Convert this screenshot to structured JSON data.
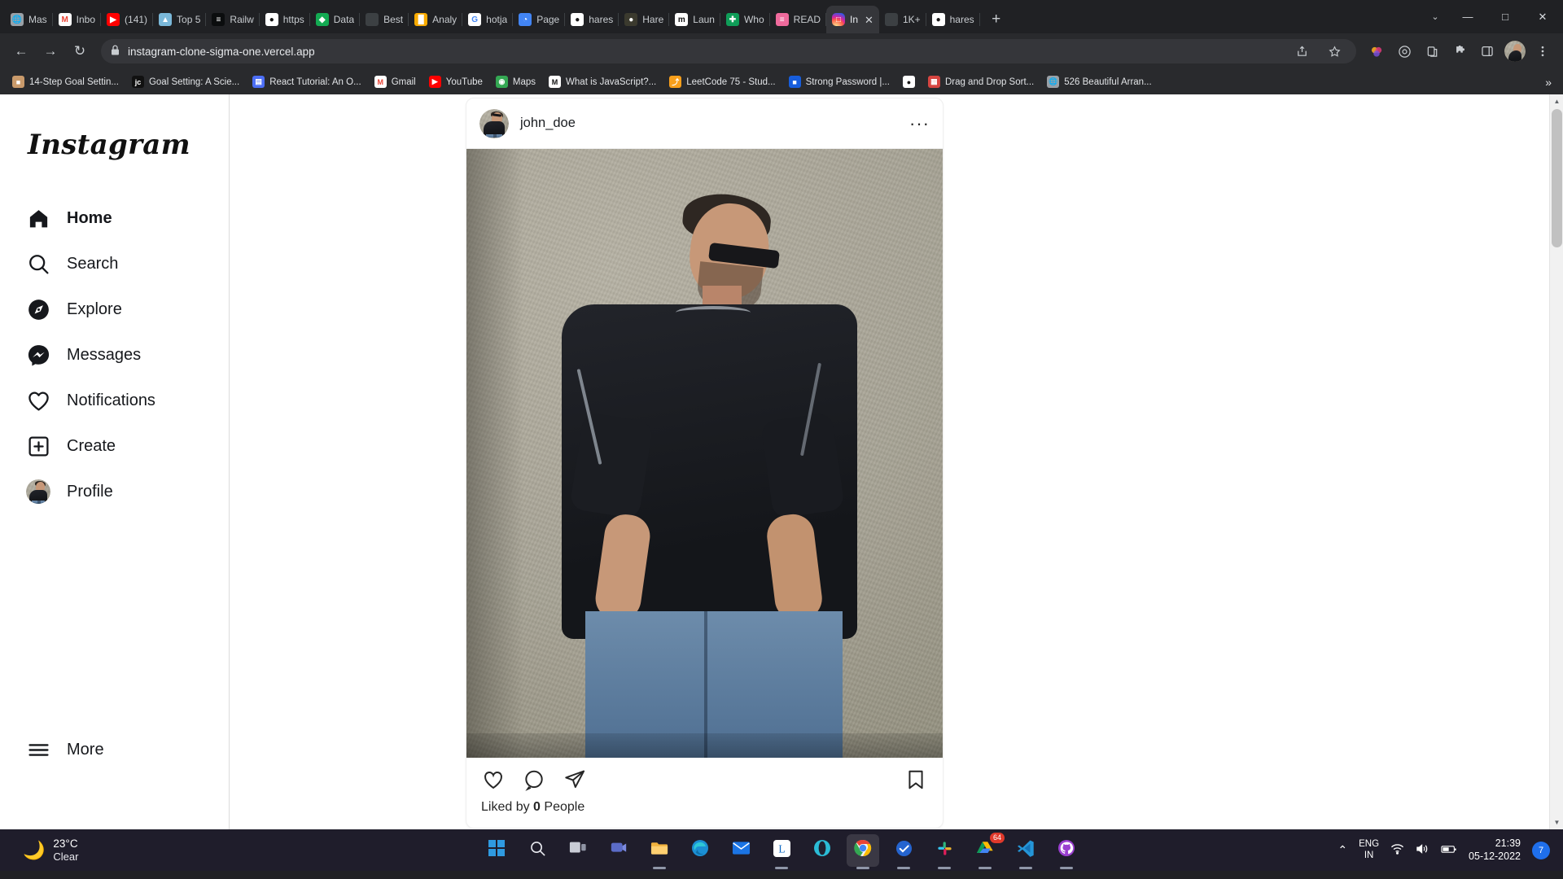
{
  "browser": {
    "tabs": [
      {
        "label": "Mas",
        "favicon": "globe-icon",
        "color": "#9aa0a6",
        "active": false
      },
      {
        "label": "Inbo",
        "favicon": "gmail-icon",
        "color": "#ffffff",
        "active": false
      },
      {
        "label": "(141)",
        "favicon": "youtube-icon",
        "color": "#ff0000",
        "active": false
      },
      {
        "label": "Top 5",
        "favicon": "mountain-icon",
        "color": "#7ab8d9",
        "active": false
      },
      {
        "label": "Railw",
        "favicon": "railway-icon",
        "color": "#0b0d0e",
        "active": false
      },
      {
        "label": "https",
        "favicon": "dark-icon",
        "color": "#dedede",
        "active": false
      },
      {
        "label": "Data",
        "favicon": "mongodb-icon",
        "color": "#13aa52",
        "active": false
      },
      {
        "label": "Best",
        "favicon": "blank-icon",
        "color": "#3c4043",
        "active": false
      },
      {
        "label": "Analy",
        "favicon": "analytics-icon",
        "color": "#f9ab00",
        "active": false
      },
      {
        "label": "hotja",
        "favicon": "google-icon",
        "color": "#ffffff",
        "active": false
      },
      {
        "label": "Page",
        "favicon": "pagespeed-icon",
        "color": "#4285f4",
        "active": false
      },
      {
        "label": "hares",
        "favicon": "github-icon",
        "color": "#ffffff",
        "active": false
      },
      {
        "label": "Hare",
        "favicon": "coin-icon",
        "color": "#3b3a2e",
        "active": false
      },
      {
        "label": "Laun",
        "favicon": "medium-icon",
        "color": "#ffffff",
        "active": false
      },
      {
        "label": "Who",
        "favicon": "sheets-icon",
        "color": "#0f9d58",
        "active": false
      },
      {
        "label": "READ",
        "favicon": "readme-icon",
        "color": "#ef6a9c",
        "active": false
      },
      {
        "label": "In",
        "favicon": "instagram-icon",
        "color": "#e1306c",
        "active": true,
        "close": "✕"
      },
      {
        "label": "1K+",
        "favicon": "blank-icon",
        "color": "#3c4043",
        "active": false
      },
      {
        "label": "hares",
        "favicon": "github-icon",
        "color": "#ffffff",
        "active": false
      }
    ],
    "new_tab_label": "+",
    "window_controls": {
      "chevron": "⌄",
      "minimize": "—",
      "maximize": "□",
      "close": "✕"
    },
    "toolbar": {
      "back": "←",
      "forward": "→",
      "reload": "↻",
      "lock": "🔒",
      "url": "instagram-clone-sigma-one.vercel.app",
      "share_icon": "share-icon",
      "bookmark_icon": "star-icon",
      "extension_icon": "puzzle-icon",
      "sidepanel_icon": "sidepanel-icon",
      "menu_icon": "kebab-menu-icon",
      "profile_icon": "profile-avatar"
    },
    "bookmarks": [
      {
        "label": "14-Step Goal Settin...",
        "favicon": "photo-icon",
        "color": "#c99a6b"
      },
      {
        "label": "Goal Setting: A Scie...",
        "favicon": "jc-icon",
        "color": "#111111"
      },
      {
        "label": "React Tutorial: An O...",
        "favicon": "book-icon",
        "color": "#4c6ef5"
      },
      {
        "label": "Gmail",
        "favicon": "gmail-icon",
        "color": "#ffffff"
      },
      {
        "label": "YouTube",
        "favicon": "youtube-icon",
        "color": "#ff0000"
      },
      {
        "label": "Maps",
        "favicon": "maps-icon",
        "color": "#34a853"
      },
      {
        "label": "What is JavaScript?...",
        "favicon": "mdn-icon",
        "color": "#ffffff"
      },
      {
        "label": "LeetCode 75 - Stud...",
        "favicon": "leetcode-icon",
        "color": "#f89f1b"
      },
      {
        "label": "Strong Password |...",
        "favicon": "bitwarden-icon",
        "color": "#175ddc"
      },
      {
        "label": "",
        "favicon": "github-icon",
        "color": "#ffffff"
      },
      {
        "label": "Drag and Drop Sort...",
        "favicon": "dnd-icon",
        "color": "#d64541"
      },
      {
        "label": "526 Beautiful Arran...",
        "favicon": "globe-icon",
        "color": "#9aa0a6"
      }
    ],
    "bookmarks_overflow": "»"
  },
  "instagram": {
    "logo": "Instagram",
    "nav": [
      {
        "label": "Home",
        "icon": "home-icon",
        "active": true
      },
      {
        "label": "Search",
        "icon": "search-icon",
        "active": false
      },
      {
        "label": "Explore",
        "icon": "compass-icon",
        "active": false
      },
      {
        "label": "Messages",
        "icon": "messenger-icon",
        "active": false
      },
      {
        "label": "Notifications",
        "icon": "heart-icon",
        "active": false
      },
      {
        "label": "Create",
        "icon": "plus-square-icon",
        "active": false
      },
      {
        "label": "Profile",
        "icon": "profile-avatar-icon",
        "active": false
      }
    ],
    "more": {
      "label": "More",
      "icon": "hamburger-icon"
    },
    "post": {
      "username": "john_doe",
      "menu": "···",
      "image_alt": "man-in-black-tshirt-and-jeans-leaning-on-wall",
      "actions": [
        {
          "name": "like-button",
          "icon": "heart-outline-icon"
        },
        {
          "name": "comment-button",
          "icon": "comment-bubble-icon"
        },
        {
          "name": "share-button",
          "icon": "paper-plane-icon"
        },
        {
          "name": "save-button",
          "icon": "bookmark-icon"
        }
      ],
      "likes_prefix": "Liked by",
      "likes_count": "0",
      "likes_suffix": "People"
    }
  },
  "taskbar": {
    "weather": {
      "icon": "moon-icon",
      "temperature": "23°C",
      "condition": "Clear"
    },
    "apps": [
      {
        "name": "start-button",
        "icon": "windows-icon",
        "running": false,
        "active": false,
        "badge": ""
      },
      {
        "name": "search-button",
        "icon": "search-icon",
        "running": false,
        "active": false,
        "badge": ""
      },
      {
        "name": "task-view-button",
        "icon": "taskview-icon",
        "running": false,
        "active": false,
        "badge": ""
      },
      {
        "name": "teams-button",
        "icon": "teams-icon",
        "running": false,
        "active": false,
        "badge": ""
      },
      {
        "name": "file-explorer-button",
        "icon": "folder-icon",
        "running": true,
        "active": false,
        "badge": ""
      },
      {
        "name": "edge-button",
        "icon": "edge-icon",
        "running": false,
        "active": false,
        "badge": ""
      },
      {
        "name": "mail-button",
        "icon": "mail-icon",
        "running": false,
        "active": false,
        "badge": ""
      },
      {
        "name": "linkedin-button",
        "icon": "linkedin-icon",
        "running": true,
        "active": false,
        "badge": ""
      },
      {
        "name": "opera-button",
        "icon": "opera-icon",
        "running": false,
        "active": false,
        "badge": ""
      },
      {
        "name": "chrome-button",
        "icon": "chrome-icon",
        "running": true,
        "active": true,
        "badge": ""
      },
      {
        "name": "todo-button",
        "icon": "check-icon",
        "running": true,
        "active": false,
        "badge": ""
      },
      {
        "name": "slack-button",
        "icon": "slack-icon",
        "running": true,
        "active": false,
        "badge": ""
      },
      {
        "name": "drive-button",
        "icon": "drive-icon",
        "running": true,
        "active": false,
        "badge": "64"
      },
      {
        "name": "vscode-button",
        "icon": "vscode-icon",
        "running": true,
        "active": false,
        "badge": ""
      },
      {
        "name": "github-desktop-button",
        "icon": "github-icon",
        "running": true,
        "active": false,
        "badge": ""
      }
    ],
    "tray": {
      "expand": "⌃",
      "language_line1": "ENG",
      "language_line2": "IN",
      "wifi_icon": "wifi-icon",
      "volume_icon": "speaker-icon",
      "battery_icon": "battery-icon",
      "time": "21:39",
      "date": "05-12-2022",
      "notification_count": "7"
    }
  },
  "scrollbar": {
    "up_arrow": "▲",
    "down_arrow": "▼"
  }
}
